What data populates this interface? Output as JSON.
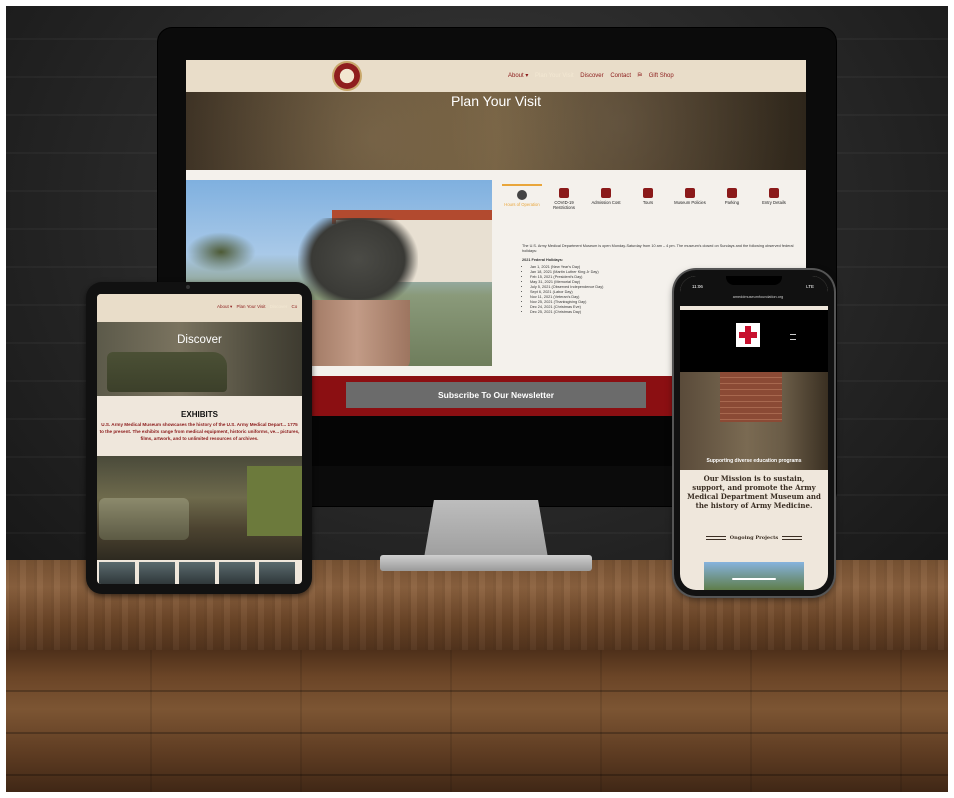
{
  "desktop": {
    "nav": {
      "items": [
        "About ▾",
        "Plan Your Visit",
        "Discover",
        "Contact",
        "Gift Shop"
      ],
      "active_index": 1,
      "gift_shop_icon": "shop-icon"
    },
    "hero_title": "Plan Your Visit",
    "tabs": [
      {
        "label": "Hours of Operation",
        "icon": "clock-icon"
      },
      {
        "label": "COVID-19 Restrictions",
        "icon": "document-icon"
      },
      {
        "label": "Admission Cost",
        "icon": "ticket-icon"
      },
      {
        "label": "Tours",
        "icon": "megaphone-icon"
      },
      {
        "label": "Museum Policies",
        "icon": "clipboard-icon"
      },
      {
        "label": "Parking",
        "icon": "parking-icon"
      },
      {
        "label": "Entry Details",
        "icon": "door-icon"
      }
    ],
    "active_tab": 0,
    "hours_text": "The U.S. Army Medical Department Museum is open Monday-Saturday from 10 am – 4 pm. The museum's closed on Sundays and the following observed federal holidays:",
    "holidays_heading": "2021 Federal Holidays:",
    "holidays": [
      "Jan 1, 2021 (New Year's Day)",
      "Jan 18, 2021 (Martin Luther King Jr Day)",
      "Feb 15, 2021 (President's Day)",
      "May 31, 2021 (Memorial Day)",
      "July 5, 2021 (Observed Independence Day)",
      "Sept 6, 2021 (Labor Day)",
      "Nov 11, 2021 (Veteran's Day)",
      "Nov 25, 2021 (Thanksgiving Day)",
      "Dec 24, 2021 (Christmas Eve)",
      "Dec 25, 2021 (Christmas Day)"
    ],
    "subscribe_label": "Subscribe To Our Newsletter"
  },
  "tablet": {
    "nav": {
      "items": [
        "About ▾",
        "Plan Your Visit",
        "Discover",
        "Co"
      ],
      "active_index": 2
    },
    "hero_title": "Discover",
    "exhibits_title": "EXHIBITS",
    "exhibits_text": "U.S. Army Medical Museum showcases the history of the U.S. Army Medical Depart... 1775 to the present. The exhibits range from medical equipment, historic uniforms, ve... pictures, films, artwork, and to unlimited resources of archives."
  },
  "phone": {
    "status_time": "11:06",
    "status_right": "LTE",
    "url": "ameddmuseumfoundation.org",
    "hero_caption": "Supporting diverse education programs",
    "mission": "Our Mission is to sustain, support, and promote the Army Medical Department Museum and the history of Army Medicine.",
    "ongoing_projects": "Ongoing Projects"
  },
  "colors": {
    "brand_red": "#8b1a1a",
    "nav_bg": "#e9ddc9",
    "active_tab_accent": "#e9a63b",
    "subscribe_band": "#8b0f12"
  }
}
